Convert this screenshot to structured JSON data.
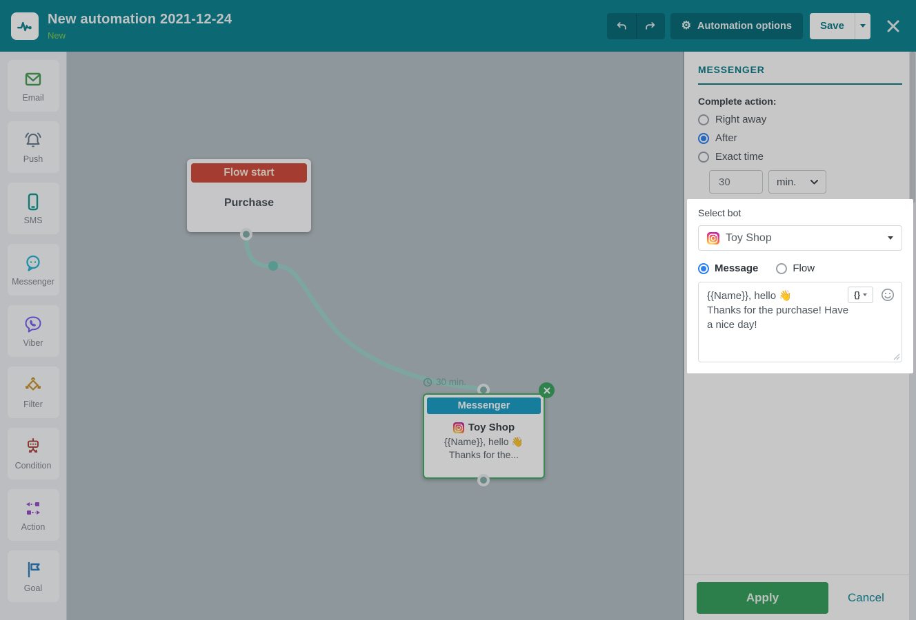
{
  "header": {
    "title": "New automation 2021-12-24",
    "subtitle": "New",
    "automation_options_label": "Automation options",
    "save_label": "Save"
  },
  "sidebar": {
    "items": [
      {
        "label": "Email",
        "icon": "email-envelope-icon",
        "color": "#4a9e52"
      },
      {
        "label": "Push",
        "icon": "push-bell-icon",
        "color": "#64788b"
      },
      {
        "label": "SMS",
        "icon": "sms-phone-icon",
        "color": "#12998e"
      },
      {
        "label": "Messenger",
        "icon": "messenger-chat-icon",
        "color": "#26b7d7"
      },
      {
        "label": "Viber",
        "icon": "viber-bubble-icon",
        "color": "#7360f2"
      },
      {
        "label": "Filter",
        "icon": "filter-branch-icon",
        "color": "#c9932b"
      },
      {
        "label": "Condition",
        "icon": "condition-robot-icon",
        "color": "#ad4a3e"
      },
      {
        "label": "Action",
        "icon": "action-arrows-icon",
        "color": "#9c4dcc"
      },
      {
        "label": "Goal",
        "icon": "goal-flag-icon",
        "color": "#2d7fc1"
      }
    ]
  },
  "canvas": {
    "flow_start": {
      "header": "Flow start",
      "trigger": "Purchase"
    },
    "delay_badge": "30 min.",
    "messenger_node": {
      "header": "Messenger",
      "bot_name": "Toy Shop",
      "line1": "{{Name}}, hello 👋",
      "line2": "Thanks for the..."
    }
  },
  "panel": {
    "heading": "MESSENGER",
    "complete_action": {
      "label": "Complete action:",
      "options": [
        "Right away",
        "After",
        "Exact time"
      ],
      "selected": "After"
    },
    "delay": {
      "value": "30",
      "unit": "min."
    },
    "select_bot": {
      "label": "Select bot",
      "bot_name": "Toy Shop"
    },
    "mode": {
      "options": [
        "Message",
        "Flow"
      ],
      "selected": "Message"
    },
    "message": {
      "text": "{{Name}}, hello 👋\nThanks for the purchase! Have a nice day!",
      "variables_button": "{}"
    },
    "footer": {
      "apply": "Apply",
      "cancel": "Cancel"
    }
  },
  "colors": {
    "header_teal": "#0d8490",
    "accent_teal": "#0d7d87",
    "flow_start_red": "#d14b3c",
    "messenger_blue": "#1a9fc4",
    "selected_green": "#43ad62",
    "apply_green": "#37a05b",
    "radio_blue": "#2f80ed",
    "subtitle_green": "#86c94f",
    "connector_teal": "#9fd2cb"
  }
}
